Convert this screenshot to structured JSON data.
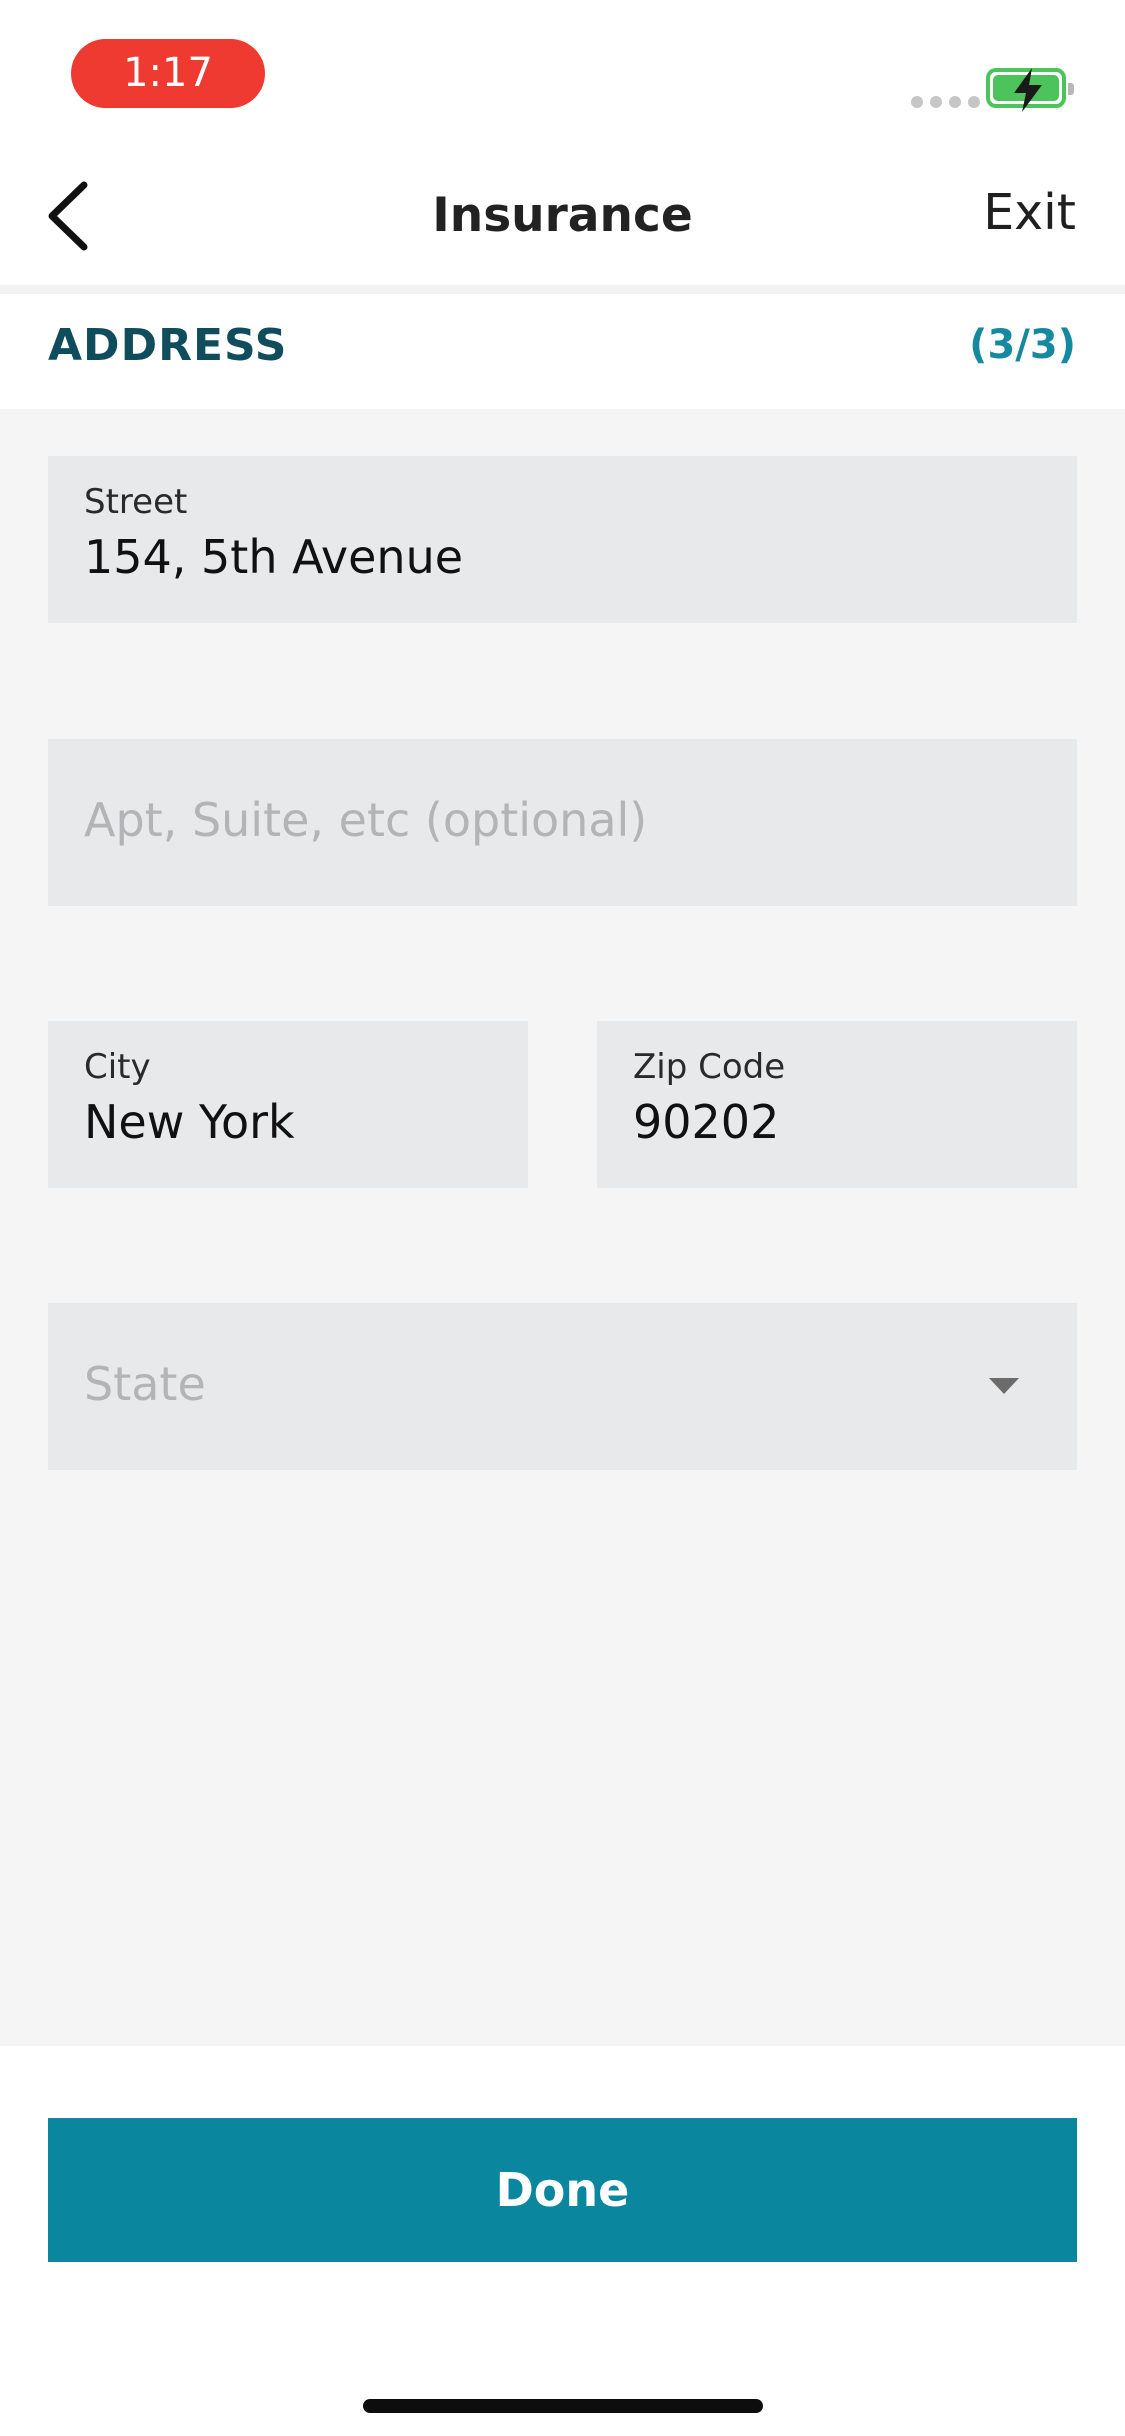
{
  "status_bar": {
    "time": "1:17",
    "accent_color": "#ee3a31",
    "battery_icon": "battery-charging-icon"
  },
  "nav": {
    "title": "Insurance",
    "exit_label": "Exit",
    "back_icon": "chevron-left-icon"
  },
  "section": {
    "title": "ADDRESS",
    "step": "(3/3)",
    "title_color": "#0f4d5c",
    "step_color": "#14899f"
  },
  "form": {
    "street": {
      "label": "Street",
      "value": "154, 5th Avenue"
    },
    "apt": {
      "placeholder": "Apt, Suite, etc (optional)",
      "value": ""
    },
    "city": {
      "label": "City",
      "value": "New York"
    },
    "zip": {
      "label": "Zip Code",
      "value": "90202"
    },
    "state": {
      "placeholder": "State",
      "value": "",
      "icon": "caret-down-icon"
    }
  },
  "actions": {
    "done_label": "Done",
    "done_color": "#0a879e"
  }
}
